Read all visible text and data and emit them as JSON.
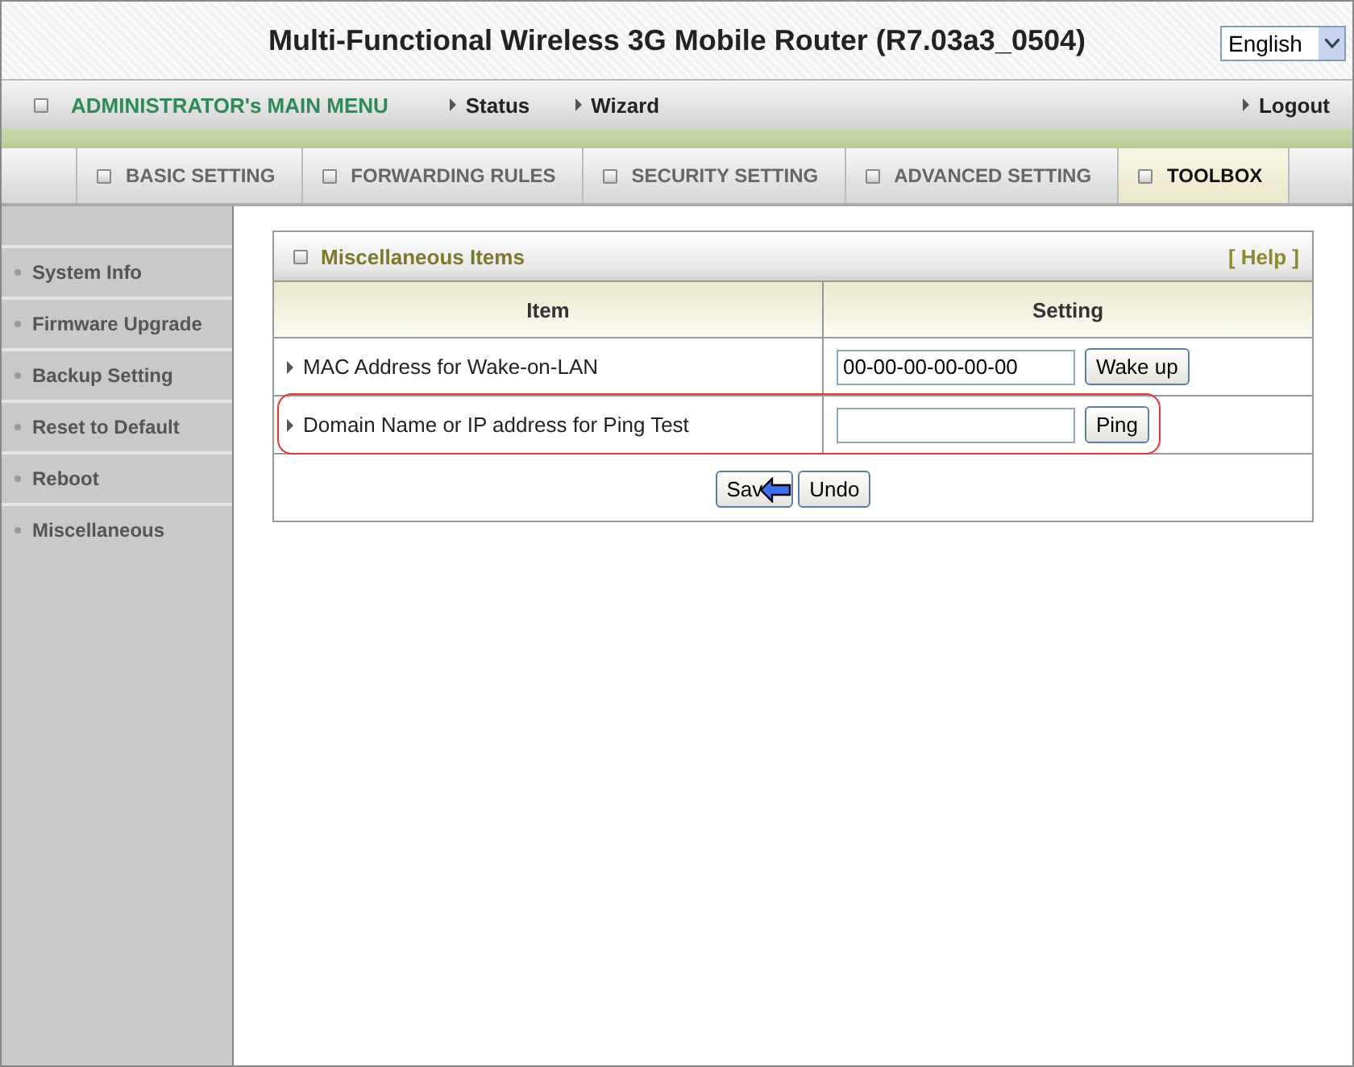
{
  "header": {
    "title": "Multi-Functional Wireless 3G Mobile Router (R7.03a3_0504)",
    "language": "English"
  },
  "menu_bar": {
    "title": "ADMINISTRATOR's MAIN MENU",
    "links": [
      "Status",
      "Wizard"
    ],
    "logout": "Logout"
  },
  "tabs": [
    {
      "label": "BASIC SETTING",
      "selected": false
    },
    {
      "label": "FORWARDING RULES",
      "selected": false
    },
    {
      "label": "SECURITY SETTING",
      "selected": false
    },
    {
      "label": "ADVANCED SETTING",
      "selected": false
    },
    {
      "label": "TOOLBOX",
      "selected": true
    }
  ],
  "sidebar": {
    "items": [
      "System Info",
      "Firmware Upgrade",
      "Backup Setting",
      "Reset to Default",
      "Reboot",
      "Miscellaneous"
    ]
  },
  "panel": {
    "title": "Miscellaneous Items",
    "help": "[ Help ]",
    "columns": [
      "Item",
      "Setting"
    ],
    "rows": [
      {
        "label": "MAC Address for Wake-on-LAN",
        "value": "00-00-00-00-00-00",
        "button": "Wake up",
        "highlighted": false
      },
      {
        "label": "Domain Name or IP address for Ping Test",
        "value": "",
        "button": "Ping",
        "highlighted": true
      }
    ],
    "buttons": [
      "Sav",
      "Undo"
    ]
  }
}
